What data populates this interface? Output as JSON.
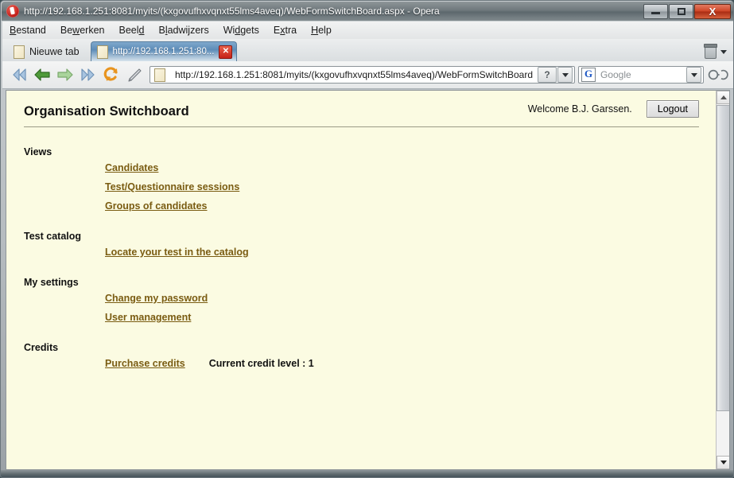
{
  "window": {
    "title": "http://192.168.1.251:8081/myits/(kxgovufhxvqnxt55lms4aveq)/WebFormSwitchBoard.aspx - Opera",
    "app_icon": "opera-logo-icon",
    "minimize_label": "",
    "maximize_label": "",
    "close_label": "X"
  },
  "menubar": {
    "items": [
      {
        "label": "Bestand",
        "mnemonic": "B"
      },
      {
        "label": "Bewerken",
        "mnemonic": "w"
      },
      {
        "label": "Beeld",
        "mnemonic": "d"
      },
      {
        "label": "Bladwijzers",
        "mnemonic": "l"
      },
      {
        "label": "Widgets",
        "mnemonic": "d"
      },
      {
        "label": "Extra",
        "mnemonic": "x"
      },
      {
        "label": "Help",
        "mnemonic": "H"
      }
    ]
  },
  "tabbar": {
    "new_tab_label": "Nieuwe tab",
    "active_tab_label": "http://192.168.1.251:80...",
    "active_tab_close": "x",
    "trash_icon": "trash-bin-icon"
  },
  "toolbar": {
    "buttons": [
      {
        "name": "rewind-button",
        "icon": "double-chevron-left-icon",
        "enabled": false
      },
      {
        "name": "back-button",
        "icon": "arrow-left-icon",
        "enabled": true
      },
      {
        "name": "forward-button",
        "icon": "arrow-right-icon",
        "enabled": false
      },
      {
        "name": "fast-forward-button",
        "icon": "double-chevron-right-icon",
        "enabled": false
      },
      {
        "name": "reload-button",
        "icon": "reload-circular-arrows-icon",
        "enabled": true
      },
      {
        "name": "edit-button",
        "icon": "pencil-icon",
        "enabled": true
      }
    ],
    "address": {
      "value": "http://192.168.1.251:8081/myits/(kxgovufhxvqnxt55lms4aveq)/WebFormSwitchBoard",
      "page_icon": "page-document-icon",
      "help_button_label": "?",
      "dropdown_icon": "chevron-down-icon"
    },
    "search": {
      "engine_icon": "google-g-icon",
      "engine_letter": "G",
      "placeholder": "Google",
      "dropdown_icon": "chevron-down-icon"
    },
    "zoom_icon": "glasses-icon"
  },
  "page": {
    "title": "Organisation Switchboard",
    "welcome": "Welcome B.J. Garssen.",
    "logout_label": "Logout",
    "sections": [
      {
        "label": "Views",
        "links": [
          {
            "label": "Candidates"
          },
          {
            "label": "Test/Questionnaire sessions"
          },
          {
            "label": "Groups of candidates"
          }
        ]
      },
      {
        "label": "Test catalog",
        "links": [
          {
            "label": "Locate your test in the catalog"
          }
        ]
      },
      {
        "label": "My settings",
        "links": [
          {
            "label": "Change my password"
          },
          {
            "label": "User management"
          }
        ]
      },
      {
        "label": "Credits",
        "links": [
          {
            "label": "Purchase credits"
          }
        ],
        "extra_text": "Current credit level : 1"
      }
    ],
    "colors": {
      "background": "#fbfbe2",
      "link": "#7a5c12",
      "text": "#111111"
    }
  },
  "scrollbar": {
    "up_icon": "triangle-up-icon",
    "down_icon": "triangle-down-icon"
  }
}
